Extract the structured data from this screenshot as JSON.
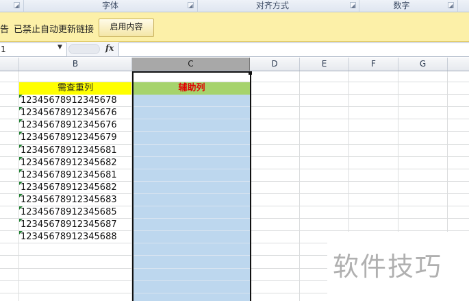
{
  "ribbon": {
    "groups": [
      {
        "label": "字体"
      },
      {
        "label": "对齐方式"
      },
      {
        "label": "数字"
      }
    ]
  },
  "message_bar": {
    "prefix_fragment": "告",
    "text": "已禁止自动更新链接",
    "button_label": "启用内容"
  },
  "formula_bar": {
    "name_box_value": "1",
    "fx_label": "fx",
    "formula_value": ""
  },
  "columns": [
    "B",
    "C",
    "D",
    "E",
    "F",
    "G"
  ],
  "sheet": {
    "b_header": "需查重列",
    "c_header": "辅助列",
    "b_values": [
      "12345678912345678",
      "12345678912345676",
      "12345678912345676",
      "12345678912345679",
      "12345678912345681",
      "12345678912345682",
      "12345678912345681",
      "12345678912345682",
      "12345678912345683",
      "12345678912345685",
      "12345678912345687",
      "12345678912345688"
    ]
  },
  "colors": {
    "b_header_bg": "#ffff00",
    "c_header_bg": "#a6d36c",
    "c_header_text": "#e00000",
    "selection_fill": "#bdd7ee",
    "message_bar_bg": "#fcf0a8"
  },
  "watermark": "软件技巧"
}
